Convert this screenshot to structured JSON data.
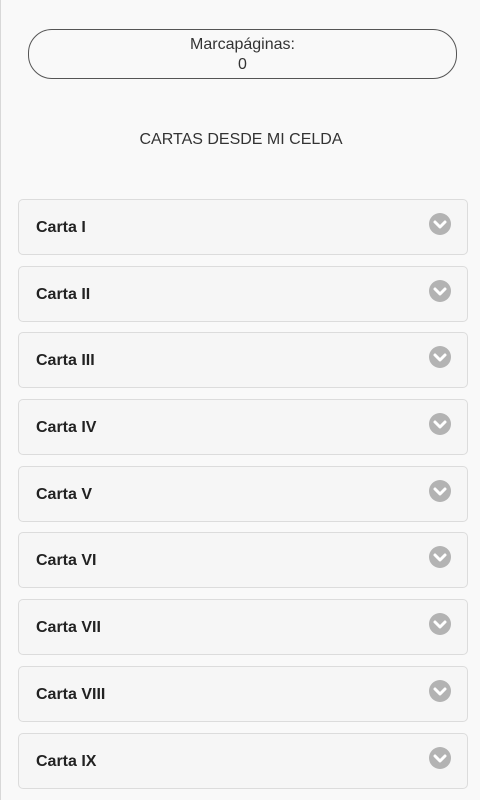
{
  "bookmarks": {
    "label": "Marcapáginas:",
    "count": "0"
  },
  "page": {
    "title": "CARTAS DESDE MI CELDA"
  },
  "letters": [
    {
      "label": "Carta I"
    },
    {
      "label": "Carta II"
    },
    {
      "label": "Carta III"
    },
    {
      "label": "Carta IV"
    },
    {
      "label": "Carta V"
    },
    {
      "label": "Carta VI"
    },
    {
      "label": "Carta VII"
    },
    {
      "label": "Carta VIII"
    },
    {
      "label": "Carta IX"
    }
  ],
  "icons": {
    "expand": "chevron-down-circle-icon"
  },
  "colors": {
    "icon_bg": "#b3b3b3",
    "item_bg": "#f6f6f6",
    "item_border": "#dcdcdc"
  }
}
